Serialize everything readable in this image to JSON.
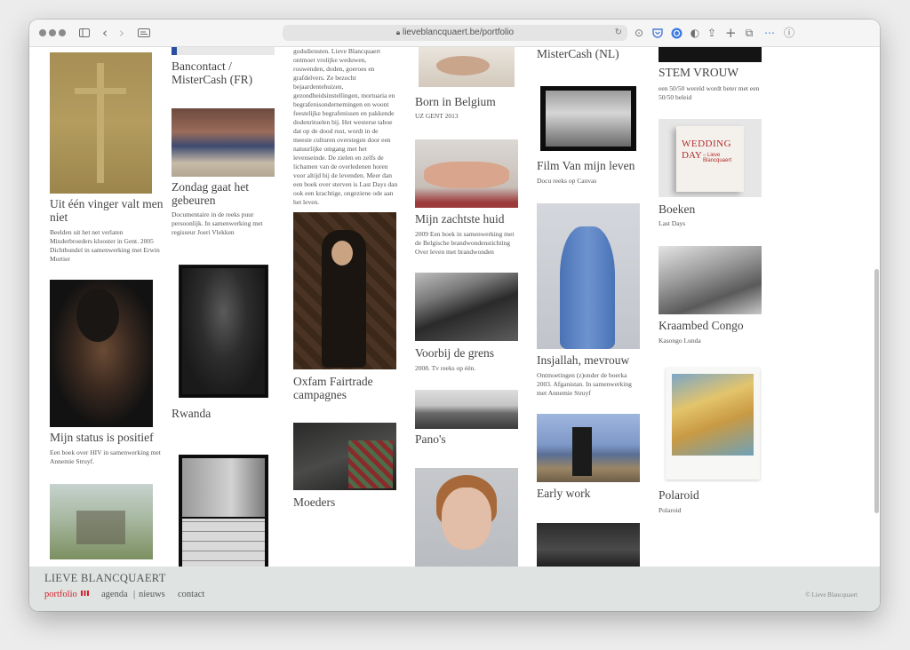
{
  "browser": {
    "url": "lieveblancquaert.be/portfolio"
  },
  "portfolio": {
    "col1": [
      {
        "title": "Uit één vinger valt men niet",
        "desc": "Beelden uit het net verlaten Minderbroeders klooster in Gent. 2005 Dichtbundel in samenwerking met Erwin Mortier"
      },
      {
        "title": "Mijn status is positief",
        "desc": "Een boek over HIV in samenwerking met Annemie Struyf."
      }
    ],
    "col2": [
      {
        "title": "Bancontact / MisterCash (FR)"
      },
      {
        "title": "Zondag gaat het gebeuren",
        "desc": "Documentaire in de reeks puur persoonlijk. In samenwerking met regisseur Joeri Vlekken"
      },
      {
        "title": "Rwanda"
      }
    ],
    "col3": [
      {
        "desc": "godsdiensten. Lieve Blancquaert ontmoet vrolijke weduwen, rouwenden, doden, goeroes en grafdelvers. Ze bezocht bejaardentehuizen, gezondheidsinstellingen, mortuaria en begrafenisondernemingen en woont feestelijke begrafenissen en pakkende dodenrituelen bij. Het westerse taboe dat op de dood rust, wordt in de meeste culturen overstegen door een natuurlijke omgang met het levenseinde. De zielen en zelfs de lichamen van de overledenen horen voor altijd bij de levenden. Meer dan een boek over sterven is Last Days dan ook een krachtige, ongeziene ode aan het leven."
      },
      {
        "title": "Oxfam Fairtrade campagnes"
      },
      {
        "title": "Moeders"
      }
    ],
    "col4": [
      {
        "title": "Born in Belgium",
        "desc": "UZ GENT 2013"
      },
      {
        "title": "Mijn zachtste huid",
        "desc": "2009 Een boek in samenwerking met de Belgische brandwondenstichting Over leven met brandwonden"
      },
      {
        "title": "Voorbij de grens",
        "desc": "2008. Tv reeks op één."
      },
      {
        "title": "Pano's"
      }
    ],
    "col5": [
      {
        "title": "MisterCash (NL)"
      },
      {
        "title": "Film Van mijn leven",
        "desc": "Docu reeks op Canvas"
      },
      {
        "title": "Insjallah, mevrouw",
        "desc": "Ontmoetingen (z)onder de boerka 2003. Afganistan. In samenwerking met Annemie Struyf"
      },
      {
        "title": "Early work"
      }
    ],
    "col6": [
      {
        "title": "STEM VROUW",
        "desc": "een 50/50 wereld wordt beter met een 50/50 beleid"
      },
      {
        "title": "Boeken",
        "desc": "Last Days",
        "cover_line1": "WEDDING",
        "cover_line2": "DAY",
        "cover_author": "– Lieve Blancquaert"
      },
      {
        "title": "Kraambed Congo",
        "desc": "Kasongo Lunda"
      },
      {
        "title": "Polaroid",
        "desc": "Polaroid"
      }
    ]
  },
  "footer": {
    "brand": "LIEVE BLANCQUAERT",
    "nav_portfolio": "portfolio",
    "nav_agenda": "agenda",
    "nav_sep": "|",
    "nav_nieuws": "nieuws",
    "nav_contact": "contact",
    "copyright": "© Lieve Blancquaert",
    "accent_color": "#d2202a"
  }
}
